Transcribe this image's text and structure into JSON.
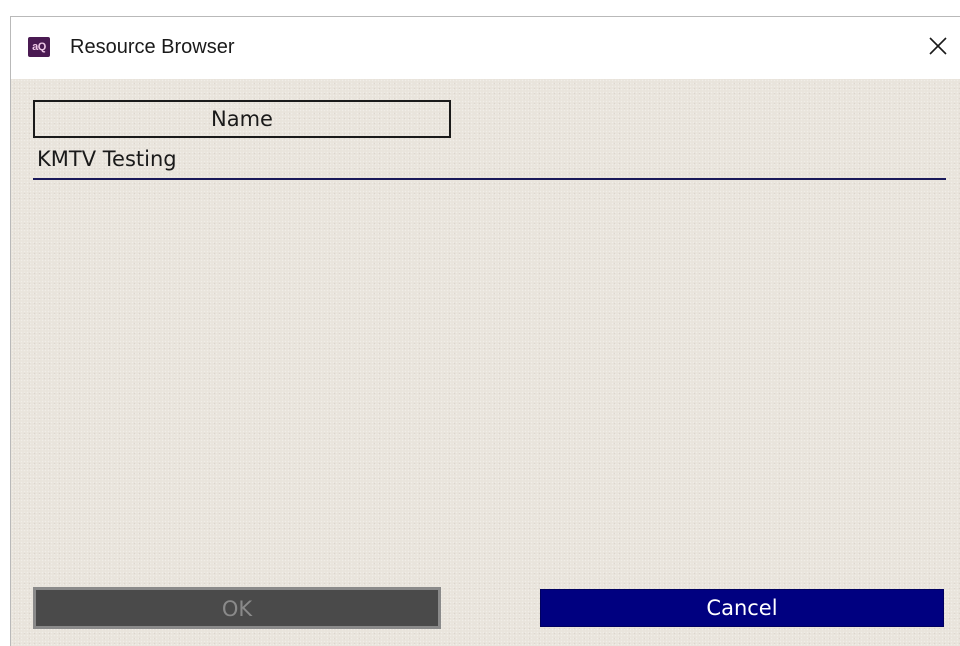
{
  "window": {
    "title": "Resource Browser",
    "app_icon_text": "aQ",
    "app_icon_color": "#4a1a52",
    "close_icon": "close-icon"
  },
  "list": {
    "column_header": "Name",
    "items": [
      {
        "name": "KMTV Testing"
      }
    ]
  },
  "buttons": {
    "ok_label": "OK",
    "ok_enabled": false,
    "cancel_label": "Cancel",
    "cancel_color": "#000080"
  }
}
